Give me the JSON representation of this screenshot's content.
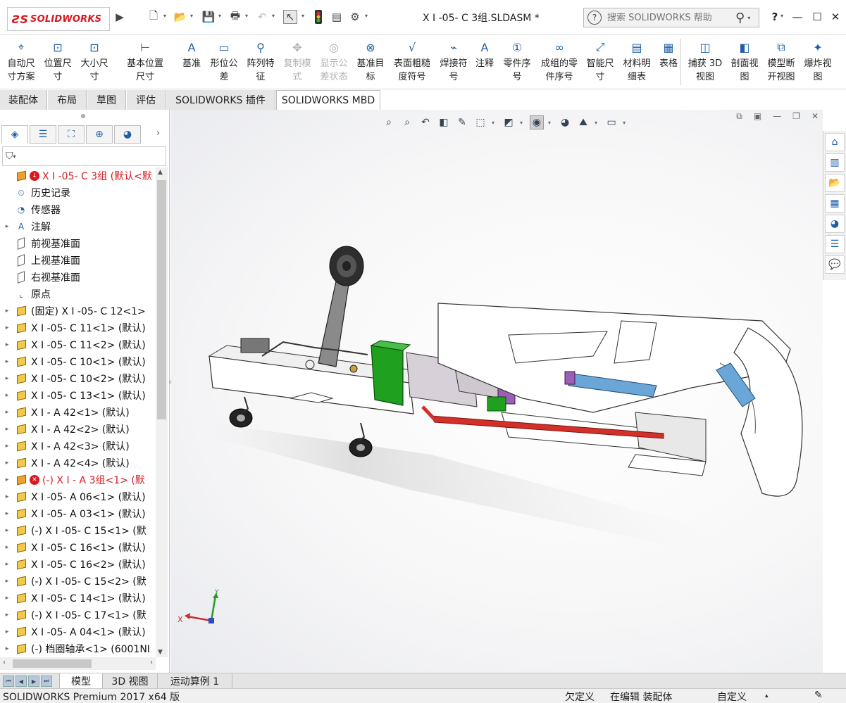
{
  "app": {
    "logo_text": "SOLIDWORKS",
    "document_title": "X I -05- C 3组.SLDASM *",
    "search_placeholder": "搜索 SOLIDWORKS 帮助",
    "help_label": "?"
  },
  "ribbon": {
    "items": [
      {
        "label": "自动尺\n寸方案",
        "icon": "auto-dimension-icon",
        "enabled": true
      },
      {
        "label": "位置尺\n寸",
        "icon": "location-dimension-icon",
        "enabled": true
      },
      {
        "label": "大小尺\n寸",
        "icon": "size-dimension-icon",
        "enabled": true
      },
      {
        "label": "基本位置尺寸",
        "icon": "basic-location-dimension-icon",
        "enabled": true
      },
      {
        "label": "基准",
        "icon": "datum-icon",
        "enabled": true
      },
      {
        "label": "形位公\n差",
        "icon": "geometric-tolerance-icon",
        "enabled": true
      },
      {
        "label": "阵列特\n征",
        "icon": "pattern-feature-icon",
        "enabled": true
      },
      {
        "label": "复制模\n式",
        "icon": "copy-scheme-icon",
        "enabled": false
      },
      {
        "label": "显示公\n差状态",
        "icon": "show-tolerance-status-icon",
        "enabled": false
      },
      {
        "label": "基准目\n标",
        "icon": "datum-target-icon",
        "enabled": true
      },
      {
        "label": "表面粗糙\n度符号",
        "icon": "surface-finish-icon",
        "enabled": true
      },
      {
        "label": "焊接符\n号",
        "icon": "weld-symbol-icon",
        "enabled": true
      },
      {
        "label": "注释",
        "icon": "note-icon",
        "enabled": true
      },
      {
        "label": "零件序\n号",
        "icon": "balloon-icon",
        "enabled": true
      },
      {
        "label": "成组的零\n件序号",
        "icon": "stacked-balloon-icon",
        "enabled": true
      },
      {
        "label": "智能尺\n寸",
        "icon": "smart-dimension-icon",
        "enabled": true
      },
      {
        "label": "材料明\n细表",
        "icon": "bom-icon",
        "enabled": true
      },
      {
        "label": "表格",
        "icon": "table-icon",
        "enabled": true
      },
      {
        "label": "捕获 3D\n视图",
        "icon": "capture-3d-view-icon",
        "enabled": true
      },
      {
        "label": "剖面视\n图",
        "icon": "section-view-icon",
        "enabled": true
      },
      {
        "label": "模型断\n开视图",
        "icon": "model-break-view-icon",
        "enabled": true
      },
      {
        "label": "爆炸视\n图",
        "icon": "exploded-view-icon",
        "enabled": true
      }
    ]
  },
  "command_tabs": [
    "装配体",
    "布局",
    "草图",
    "评估",
    "SOLIDWORKS 插件",
    "SOLIDWORKS MBD"
  ],
  "active_command_tab": "SOLIDWORKS MBD",
  "feature_tree": {
    "items": [
      {
        "label": "X I -05- C 3组 (默认<默",
        "icon": "assembly-icon",
        "expand": "",
        "warn": true,
        "red": true
      },
      {
        "label": "历史记录",
        "icon": "history-icon",
        "expand": ""
      },
      {
        "label": "传感器",
        "icon": "sensor-icon",
        "expand": ""
      },
      {
        "label": "注解",
        "icon": "annotation-icon",
        "expand": "▸"
      },
      {
        "label": "前视基准面",
        "icon": "plane-icon",
        "expand": ""
      },
      {
        "label": "上视基准面",
        "icon": "plane-icon",
        "expand": ""
      },
      {
        "label": "右视基准面",
        "icon": "plane-icon",
        "expand": ""
      },
      {
        "label": "原点",
        "icon": "origin-icon",
        "expand": ""
      },
      {
        "label": "(固定) X I -05- C 12<1>",
        "icon": "part-icon",
        "expand": "▸"
      },
      {
        "label": "X I -05- C 11<1> (默认)",
        "icon": "part-icon",
        "expand": "▸"
      },
      {
        "label": "X I -05- C 11<2> (默认)",
        "icon": "part-icon",
        "expand": "▸"
      },
      {
        "label": "X I -05- C 10<1> (默认)",
        "icon": "part-icon",
        "expand": "▸"
      },
      {
        "label": "X I -05- C 10<2> (默认)",
        "icon": "part-icon",
        "expand": "▸"
      },
      {
        "label": "X I -05- C 13<1> (默认)",
        "icon": "part-icon",
        "expand": "▸"
      },
      {
        "label": "X I - A 42<1> (默认)",
        "icon": "part-icon",
        "expand": "▸"
      },
      {
        "label": "X I - A 42<2> (默认)",
        "icon": "part-icon",
        "expand": "▸"
      },
      {
        "label": "X I - A 42<3> (默认)",
        "icon": "part-icon",
        "expand": "▸"
      },
      {
        "label": "X I - A 42<4> (默认)",
        "icon": "part-icon",
        "expand": "▸"
      },
      {
        "label": "(-) X I - A 3组<1> (默",
        "icon": "subassembly-icon",
        "expand": "▸",
        "error": true,
        "red": true
      },
      {
        "label": "X I -05- A 06<1> (默认)",
        "icon": "part-icon",
        "expand": "▸"
      },
      {
        "label": "X I -05- A 03<1> (默认)",
        "icon": "part-icon",
        "expand": "▸"
      },
      {
        "label": "(-) X I -05- C 15<1> (默",
        "icon": "part-icon",
        "expand": "▸"
      },
      {
        "label": "X I -05- C 16<1> (默认)",
        "icon": "part-icon",
        "expand": "▸"
      },
      {
        "label": "X I -05- C 16<2> (默认)",
        "icon": "part-icon",
        "expand": "▸"
      },
      {
        "label": "(-) X I -05- C 15<2> (默",
        "icon": "part-icon",
        "expand": "▸"
      },
      {
        "label": "X I -05- C 14<1> (默认)",
        "icon": "part-icon",
        "expand": "▸"
      },
      {
        "label": "(-) X I -05- C 17<1> (默",
        "icon": "part-icon",
        "expand": "▸"
      },
      {
        "label": "X I -05- A 04<1> (默认)",
        "icon": "part-icon",
        "expand": "▸"
      },
      {
        "label": "(-) 档圈轴承<1> (6001NI",
        "icon": "part-icon",
        "expand": "▸"
      }
    ]
  },
  "triad": {
    "x_label": "X",
    "y_label": "Y"
  },
  "bottom_tabs": [
    "模型",
    "3D 视图",
    "运动算例 1"
  ],
  "active_bottom_tab": "模型",
  "status": {
    "product": "SOLIDWORKS Premium 2017 x64 版",
    "definition": "欠定义",
    "mode": "在编辑 装配体",
    "units": "自定义"
  },
  "colors": {
    "brand_red": "#d71920",
    "frame_green": "#1fa01f",
    "bar_red": "#d4302a",
    "cylinder_blue": "#6aa7d8",
    "purple": "#9b5fb5"
  }
}
